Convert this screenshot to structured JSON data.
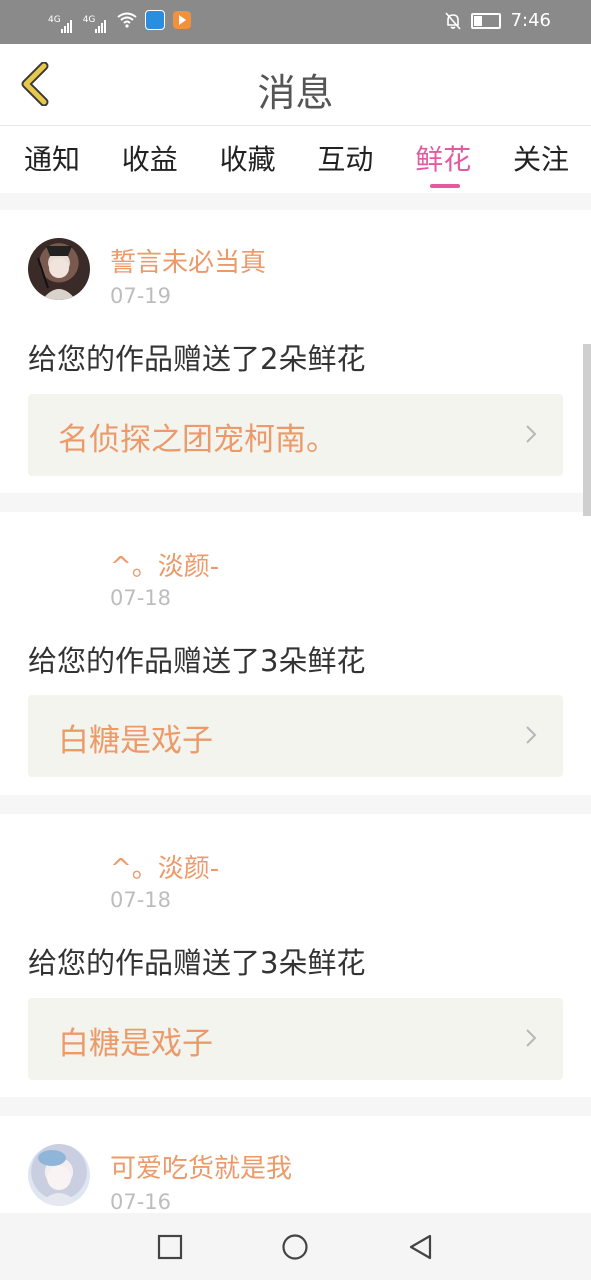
{
  "status_bar": {
    "signal1": "4G",
    "signal2": "4G",
    "time": "7:46"
  },
  "header": {
    "title": "消息"
  },
  "tabs": [
    {
      "label": "通知",
      "active": false
    },
    {
      "label": "收益",
      "active": false
    },
    {
      "label": "收藏",
      "active": false
    },
    {
      "label": "互动",
      "active": false
    },
    {
      "label": "鲜花",
      "active": true
    },
    {
      "label": "关注",
      "active": false
    }
  ],
  "messages": [
    {
      "user": "誓言未必当真",
      "date": "07-19",
      "text": "给您的作品赠送了2朵鲜花",
      "work": "名侦探之团宠柯南。",
      "has_avatar": true
    },
    {
      "user": "^。淡颜-",
      "date": "07-18",
      "text": "给您的作品赠送了3朵鲜花",
      "work": "白糖是戏子",
      "has_avatar": false
    },
    {
      "user": "^。淡颜-",
      "date": "07-18",
      "text": "给您的作品赠送了3朵鲜花",
      "work": "白糖是戏子",
      "has_avatar": false
    },
    {
      "user": "可爱吃货就是我",
      "date": "07-16",
      "text": "",
      "work": "",
      "has_avatar": true
    }
  ],
  "colors": {
    "accent": "#e45aa0",
    "username": "#ec9a6a",
    "status_bar": "#8a8a8a",
    "back_arrow": "#e8c84a"
  }
}
